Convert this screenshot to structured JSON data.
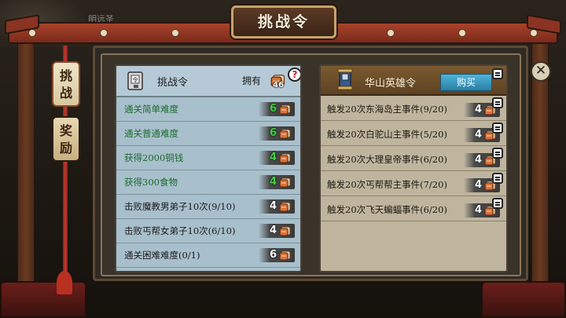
{
  "background": {
    "player_name": "明远圣"
  },
  "title": "挑战令",
  "tabs": [
    {
      "label_top": "挑",
      "label_bottom": "战",
      "active": true
    },
    {
      "label_top": "奖",
      "label_bottom": "励",
      "active": false
    }
  ],
  "challenge_panel": {
    "title": "挑战令",
    "own_label": "拥有",
    "own_count": "46",
    "tasks": [
      {
        "text": "通关简单难度",
        "reward": "6",
        "done": true
      },
      {
        "text": "通关普通难度",
        "reward": "6",
        "done": true
      },
      {
        "text": "获得2000铜钱",
        "reward": "4",
        "done": true
      },
      {
        "text": "获得300食物",
        "reward": "4",
        "done": true
      },
      {
        "text": "击败魔教男弟子10次(9/10)",
        "reward": "4",
        "done": false
      },
      {
        "text": "击败丐帮女弟子10次(6/10)",
        "reward": "4",
        "done": false
      },
      {
        "text": "通关困难难度(0/1)",
        "reward": "6",
        "done": false
      }
    ]
  },
  "hero_panel": {
    "title": "华山英雄令",
    "buy_label": "购买",
    "events": [
      {
        "text": "触发20次东海岛主事件(9/20)",
        "reward": "4"
      },
      {
        "text": "触发20次白驼山主事件(5/20)",
        "reward": "4"
      },
      {
        "text": "触发20次大理皇帝事件(6/20)",
        "reward": "4"
      },
      {
        "text": "触发20次丐帮帮主事件(7/20)",
        "reward": "4"
      },
      {
        "text": "触发20次飞天蝙蝠事件(6/20)",
        "reward": "4"
      }
    ]
  },
  "colors": {
    "done_text": "#1d6b2e",
    "done_number": "#40d040",
    "buy_button": "#3a9ac4"
  },
  "icons": [
    "close-icon",
    "help-icon",
    "token-icon",
    "challenge-token-icon",
    "hero-token-icon",
    "lock-icon"
  ]
}
